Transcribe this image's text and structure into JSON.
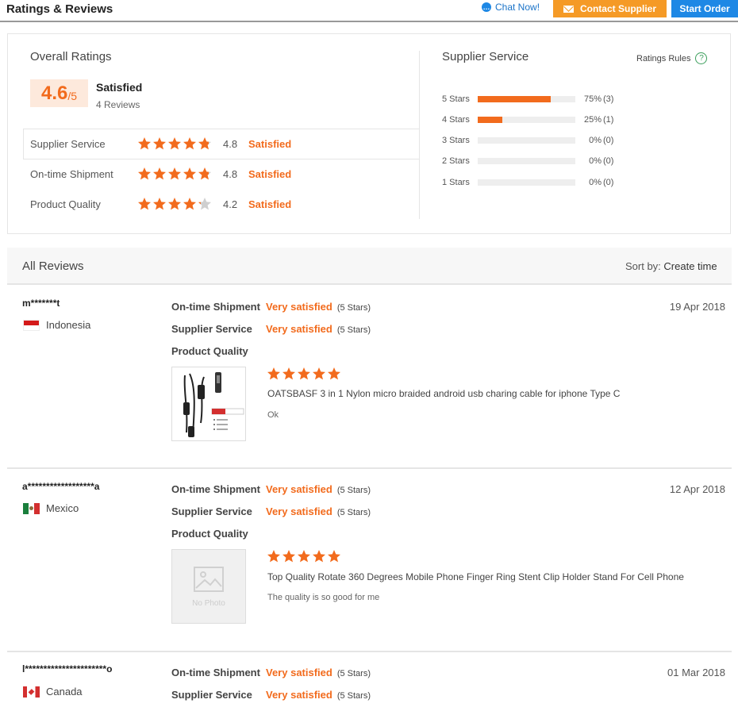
{
  "header": {
    "title": "Ratings & Reviews",
    "chat_label": "Chat Now!",
    "contact_label": "Contact Supplier",
    "order_label": "Start Order"
  },
  "overall": {
    "title": "Overall Ratings",
    "score": "4.6",
    "score_max": "/5",
    "verdict": "Satisfied",
    "reviews_count": "4 Reviews",
    "metrics": [
      {
        "label": "Supplier Service",
        "rating": 4.8,
        "value": "4.8",
        "status": "Satisfied"
      },
      {
        "label": "On-time Shipment",
        "rating": 4.8,
        "value": "4.8",
        "status": "Satisfied"
      },
      {
        "label": "Product Quality",
        "rating": 4.2,
        "value": "4.2",
        "status": "Satisfied"
      }
    ]
  },
  "supplier_service": {
    "title": "Supplier Service",
    "rules_label": "Ratings Rules",
    "distribution": [
      {
        "label": "5 Stars",
        "fraction": 0.75,
        "percent": "75%",
        "count": "(3)"
      },
      {
        "label": "4 Stars",
        "fraction": 0.25,
        "percent": "25%",
        "count": "(1)"
      },
      {
        "label": "3 Stars",
        "fraction": 0,
        "percent": "0%",
        "count": "(0)"
      },
      {
        "label": "2 Stars",
        "fraction": 0,
        "percent": "0%",
        "count": "(0)"
      },
      {
        "label": "1 Stars",
        "fraction": 0,
        "percent": "0%",
        "count": "(0)"
      }
    ]
  },
  "all_reviews": {
    "title": "All Reviews",
    "sort_prefix": "Sort by:",
    "sort_value": " Create time"
  },
  "reviews": [
    {
      "user": "m*******t",
      "country": "Indonesia",
      "flag": "indonesia-flag",
      "date": "19 Apr 2018",
      "ontime_label": "On-time Shipment",
      "ontime_value": "Very satisfied",
      "ontime_stars": "(5 Stars)",
      "service_label": "Supplier Service",
      "service_value": "Very satisfied",
      "service_stars": "(5 Stars)",
      "quality_label": "Product Quality",
      "product_rating": 5,
      "product_name": "OATSBASF 3 in 1 Nylon micro braided android usb charing cable for iphone Type C",
      "comment": "Ok",
      "image": "cable-product-image"
    },
    {
      "user": "a******************a",
      "country": "Mexico",
      "flag": "mexico-flag",
      "date": "12 Apr 2018",
      "ontime_label": "On-time Shipment",
      "ontime_value": "Very satisfied",
      "ontime_stars": "(5 Stars)",
      "service_label": "Supplier Service",
      "service_value": "Very satisfied",
      "service_stars": "(5 Stars)",
      "quality_label": "Product Quality",
      "product_rating": 5,
      "product_name": "Top Quality Rotate 360 Degrees Mobile Phone Finger Ring Stent Clip Holder Stand For Cell Phone",
      "comment": "The quality is so good for me",
      "image": "no-photo-placeholder",
      "no_photo_label": "No Photo"
    },
    {
      "user": "l**********************o",
      "country": "Canada",
      "flag": "canada-flag",
      "date": "01 Mar 2018",
      "ontime_label": "On-time Shipment",
      "ontime_value": "Very satisfied",
      "ontime_stars": "(5 Stars)",
      "service_label": "Supplier Service",
      "service_value": "Very satisfied",
      "service_stars": "(5 Stars)"
    }
  ],
  "colors": {
    "accent_orange": "#f26b1d",
    "contact_button": "#f59a26",
    "order_button": "#1e88e5"
  }
}
